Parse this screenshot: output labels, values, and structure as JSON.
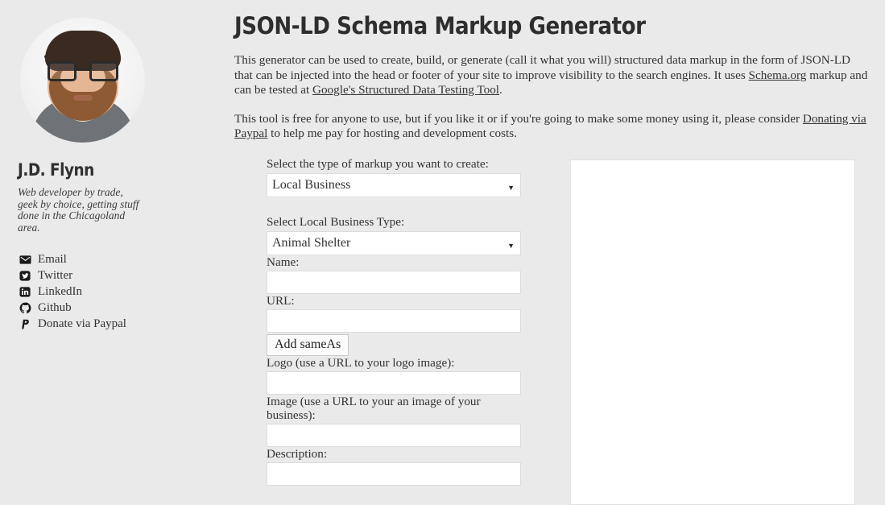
{
  "theme": {
    "page_background": "#eaeaea",
    "text_color": "#333333",
    "heading_color": "#2e2e2e",
    "input_background": "#ffffff",
    "input_border": "#dcdcdc",
    "panel_border": "#e1e1e1"
  },
  "sidebar": {
    "avatar_alt": "Portrait photo of J.D. Flynn",
    "name": "J.D. Flynn",
    "tagline": "Web developer by trade, geek by choice, getting stuff done in the Chicagoland area.",
    "links": [
      {
        "label": "Email",
        "icon": "envelope-icon"
      },
      {
        "label": "Twitter",
        "icon": "twitter-icon"
      },
      {
        "label": "LinkedIn",
        "icon": "linkedin-icon"
      },
      {
        "label": "Github",
        "icon": "github-icon"
      },
      {
        "label": "Donate via Paypal",
        "icon": "paypal-icon"
      }
    ]
  },
  "main": {
    "title": "JSON-LD Schema Markup Generator",
    "paragraph_1": {
      "part_1": "This generator can be used to create, build, or generate (call it what you will) structured data markup in the form of JSON-LD that can be injected into the head or footer of your site to improve visibility to the search engines. It uses ",
      "link_1": "Schema.org",
      "part_2": " markup and can be tested at ",
      "link_2": "Google's Structured Data Testing Tool",
      "part_3": "."
    },
    "paragraph_2": {
      "part_1": "This tool is free for anyone to use, but if you like it or if you're going to make some money using it, please consider ",
      "link_1": "Donating via Paypal",
      "part_2": " to help me pay for hosting and development costs."
    }
  },
  "form": {
    "markup_type": {
      "label": "Select the type of markup you want to create:",
      "value": "Local Business",
      "options": [
        "Local Business"
      ],
      "arrow": "▼"
    },
    "business_type": {
      "label": "Select Local Business Type:",
      "value": "Animal Shelter",
      "options": [
        "Animal Shelter"
      ],
      "arrow": "▼"
    },
    "name": {
      "label": "Name:",
      "value": "",
      "placeholder": ""
    },
    "url": {
      "label": "URL:",
      "value": "",
      "placeholder": ""
    },
    "add_sameas_button": "Add sameAs",
    "logo": {
      "label": "Logo (use a URL to your logo image):",
      "value": "",
      "placeholder": ""
    },
    "image": {
      "label": "Image (use a URL to your an image of your business):",
      "value": "",
      "placeholder": ""
    },
    "description": {
      "label": "Description:",
      "value": "",
      "placeholder": ""
    }
  },
  "output": {
    "content": ""
  }
}
